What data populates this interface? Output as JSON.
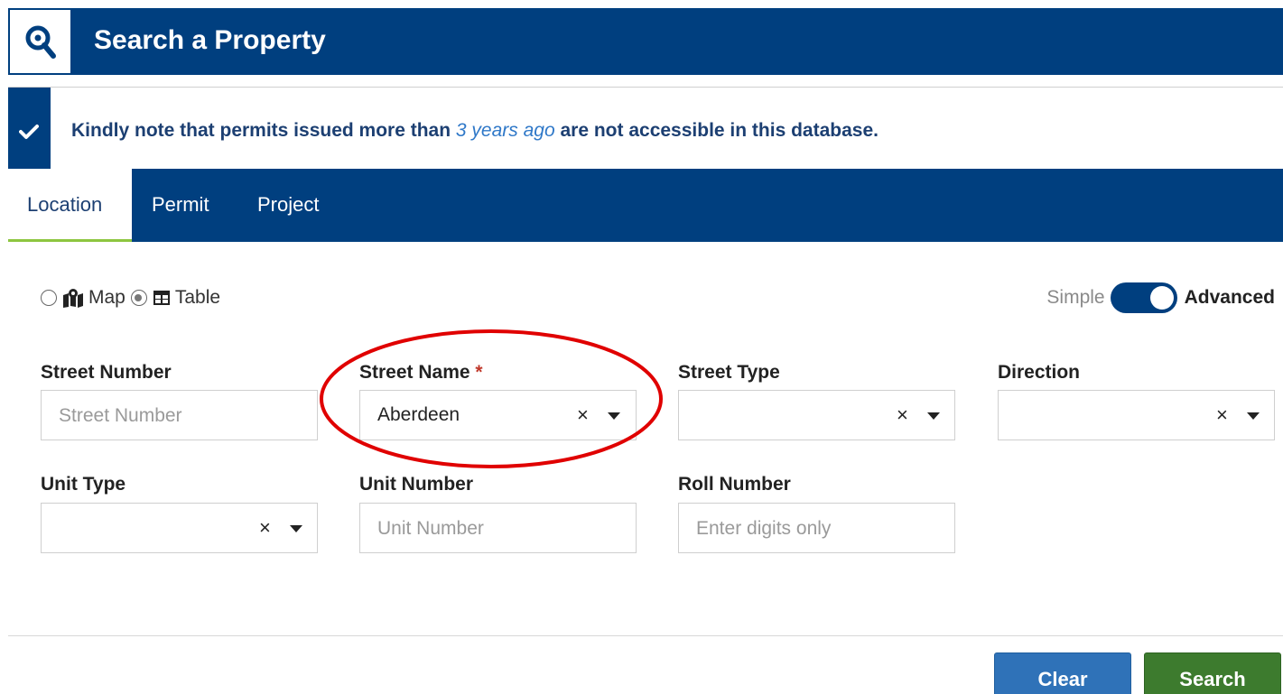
{
  "header": {
    "title": "Search a Property",
    "icon": "search-icon",
    "bg_color": "#003f7f"
  },
  "notice": {
    "text_before": "Kindly note that permits issued more than ",
    "text_emphasis": "3 years ago",
    "text_after": " are not accessible in this database.",
    "icon": "check-icon"
  },
  "tabs": [
    {
      "label": "Location",
      "active": true
    },
    {
      "label": "Permit",
      "active": false
    },
    {
      "label": "Project",
      "active": false
    }
  ],
  "view_options": {
    "map_label": "Map",
    "table_label": "Table",
    "selected": "Table"
  },
  "mode_toggle": {
    "simple_label": "Simple",
    "advanced_label": "Advanced",
    "selected": "Advanced"
  },
  "fields": {
    "street_number": {
      "label": "Street Number",
      "placeholder": "Street Number",
      "value": ""
    },
    "street_name": {
      "label": "Street Name",
      "required_mark": "*",
      "value": "Aberdeen"
    },
    "street_type": {
      "label": "Street Type",
      "value": ""
    },
    "direction": {
      "label": "Direction",
      "value": ""
    },
    "unit_type": {
      "label": "Unit Type",
      "value": ""
    },
    "unit_number": {
      "label": "Unit Number",
      "placeholder": "Unit Number",
      "value": ""
    },
    "roll_number": {
      "label": "Roll Number",
      "placeholder": "Enter digits only",
      "value": ""
    }
  },
  "clear_glyph": "×",
  "buttons": {
    "clear": "Clear",
    "search": "Search"
  },
  "colors": {
    "primary": "#003f7f",
    "tab_underline": "#8dc63f",
    "clear_button": "#2f72b8",
    "search_button": "#3d7b2e",
    "highlight_ring": "#e00000"
  }
}
